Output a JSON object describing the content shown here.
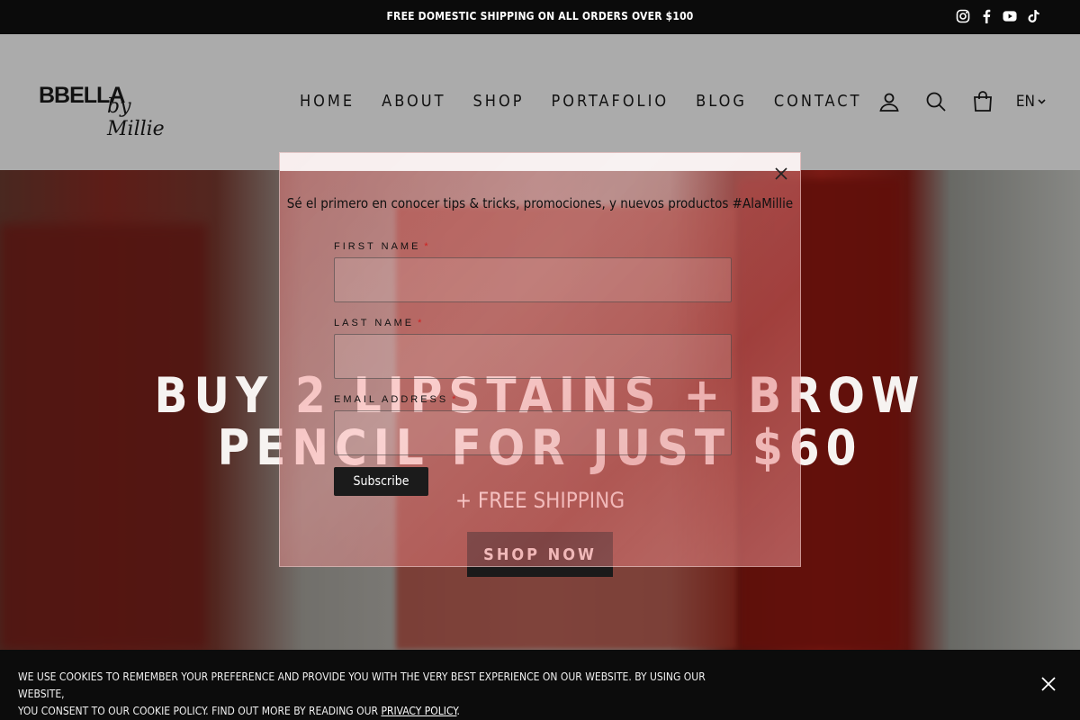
{
  "announcement": {
    "text": "FREE DOMESTIC SHIPPING ON ALL ORDERS OVER $100",
    "social_icons": [
      "instagram-icon",
      "facebook-icon",
      "youtube-icon",
      "tiktok-icon"
    ]
  },
  "header": {
    "logo_main": "BBELLA",
    "logo_sub": "by Millie",
    "nav": [
      "HOME",
      "ABOUT",
      "SHOP",
      "PORTAFOLIO",
      "BLOG",
      "CONTACT"
    ],
    "icons": [
      "account-icon",
      "search-icon",
      "cart-icon"
    ],
    "language": "EN"
  },
  "hero": {
    "title_line1": "BUY 2 LIPSTAINS + BROW",
    "title_line2": "PENCIL FOR JUST $60",
    "subtitle": "+ FREE SHIPPING",
    "button_label": "SHOP NOW"
  },
  "modal": {
    "headline": "Sé el primero en conocer tips & tricks, promociones, y nuevos productos #AlaMillie",
    "fields": [
      {
        "label": "FIRST NAME",
        "required": "*",
        "value": ""
      },
      {
        "label": "LAST NAME",
        "required": "*",
        "value": ""
      },
      {
        "label": "EMAIL ADDRESS",
        "required": "*",
        "value": ""
      }
    ],
    "subscribe_label": "Subscribe"
  },
  "cookie": {
    "line1": "WE USE COOKIES TO REMEMBER YOUR PREFERENCE AND PROVIDE YOU WITH THE VERY BEST EXPERIENCE ON OUR WEBSITE. BY USING OUR WEBSITE,",
    "line2": "YOU CONSENT TO OUR COOKIE POLICY. FIND OUT MORE BY READING OUR ",
    "link": "PRIVACY POLICY",
    "period": "."
  },
  "colors": {
    "accent": "#c4161c",
    "dark": "#0b0b0b",
    "header_bg": "#ababab"
  }
}
